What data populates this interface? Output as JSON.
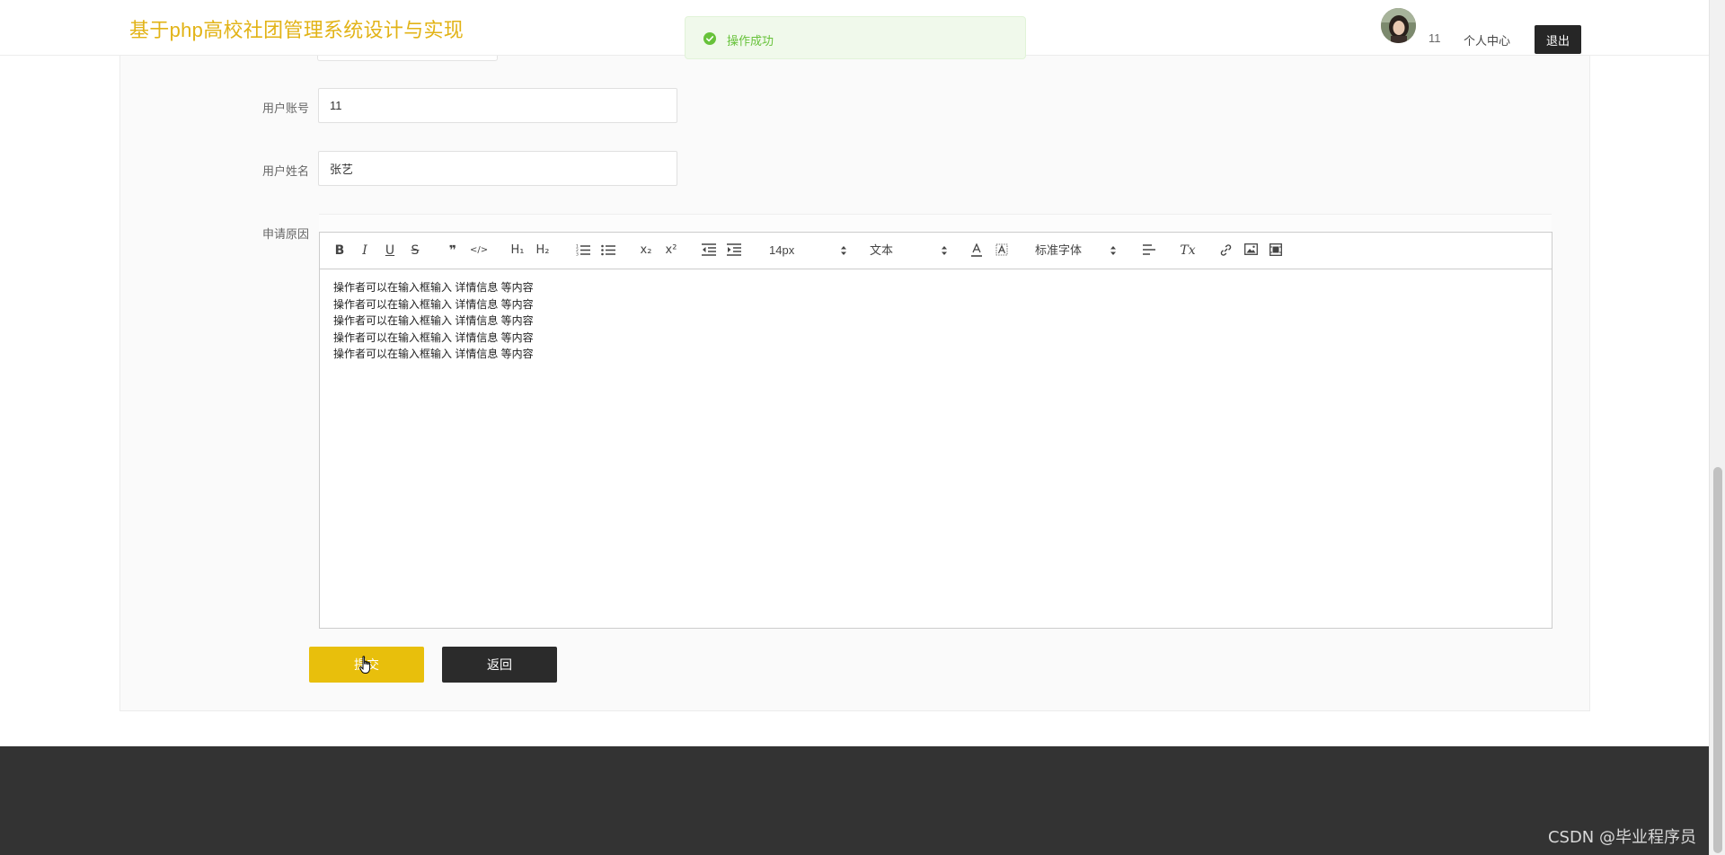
{
  "header": {
    "site_title": "基于php高校社团管理系统设计与实现",
    "username": "11",
    "personal_center": "个人中心",
    "logout": "退出"
  },
  "toast": {
    "message": "操作成功",
    "type": "success"
  },
  "form": {
    "account": {
      "label": "用户账号",
      "value": "11"
    },
    "name": {
      "label": "用户姓名",
      "value": "张艺"
    },
    "reason": {
      "label": "申请原因",
      "content_lines": [
        "操作者可以在输入框输入  详情信息  等内容",
        "操作者可以在输入框输入  详情信息  等内容",
        "操作者可以在输入框输入  详情信息  等内容",
        "操作者可以在输入框输入  详情信息  等内容",
        "操作者可以在输入框输入  详情信息  等内容"
      ]
    }
  },
  "editor_toolbar": {
    "bold": "B",
    "italic": "I",
    "underline": "U",
    "strike": "S",
    "blockquote": "❞",
    "code": "</>",
    "h1": "H₁",
    "h2": "H₂",
    "subscript": "x₂",
    "superscript": "x²",
    "font_size": "14px",
    "block_type": "文本",
    "font_family": "标准字体",
    "clear_format": "Tx"
  },
  "buttons": {
    "submit": "提交",
    "back": "返回"
  },
  "footer": {
    "watermark": "CSDN @毕业程序员"
  },
  "colors": {
    "brand": "#e2b316",
    "submit": "#e8bf0c",
    "dark": "#2b2b2b",
    "success": "#67c23a",
    "footer": "#333333"
  }
}
